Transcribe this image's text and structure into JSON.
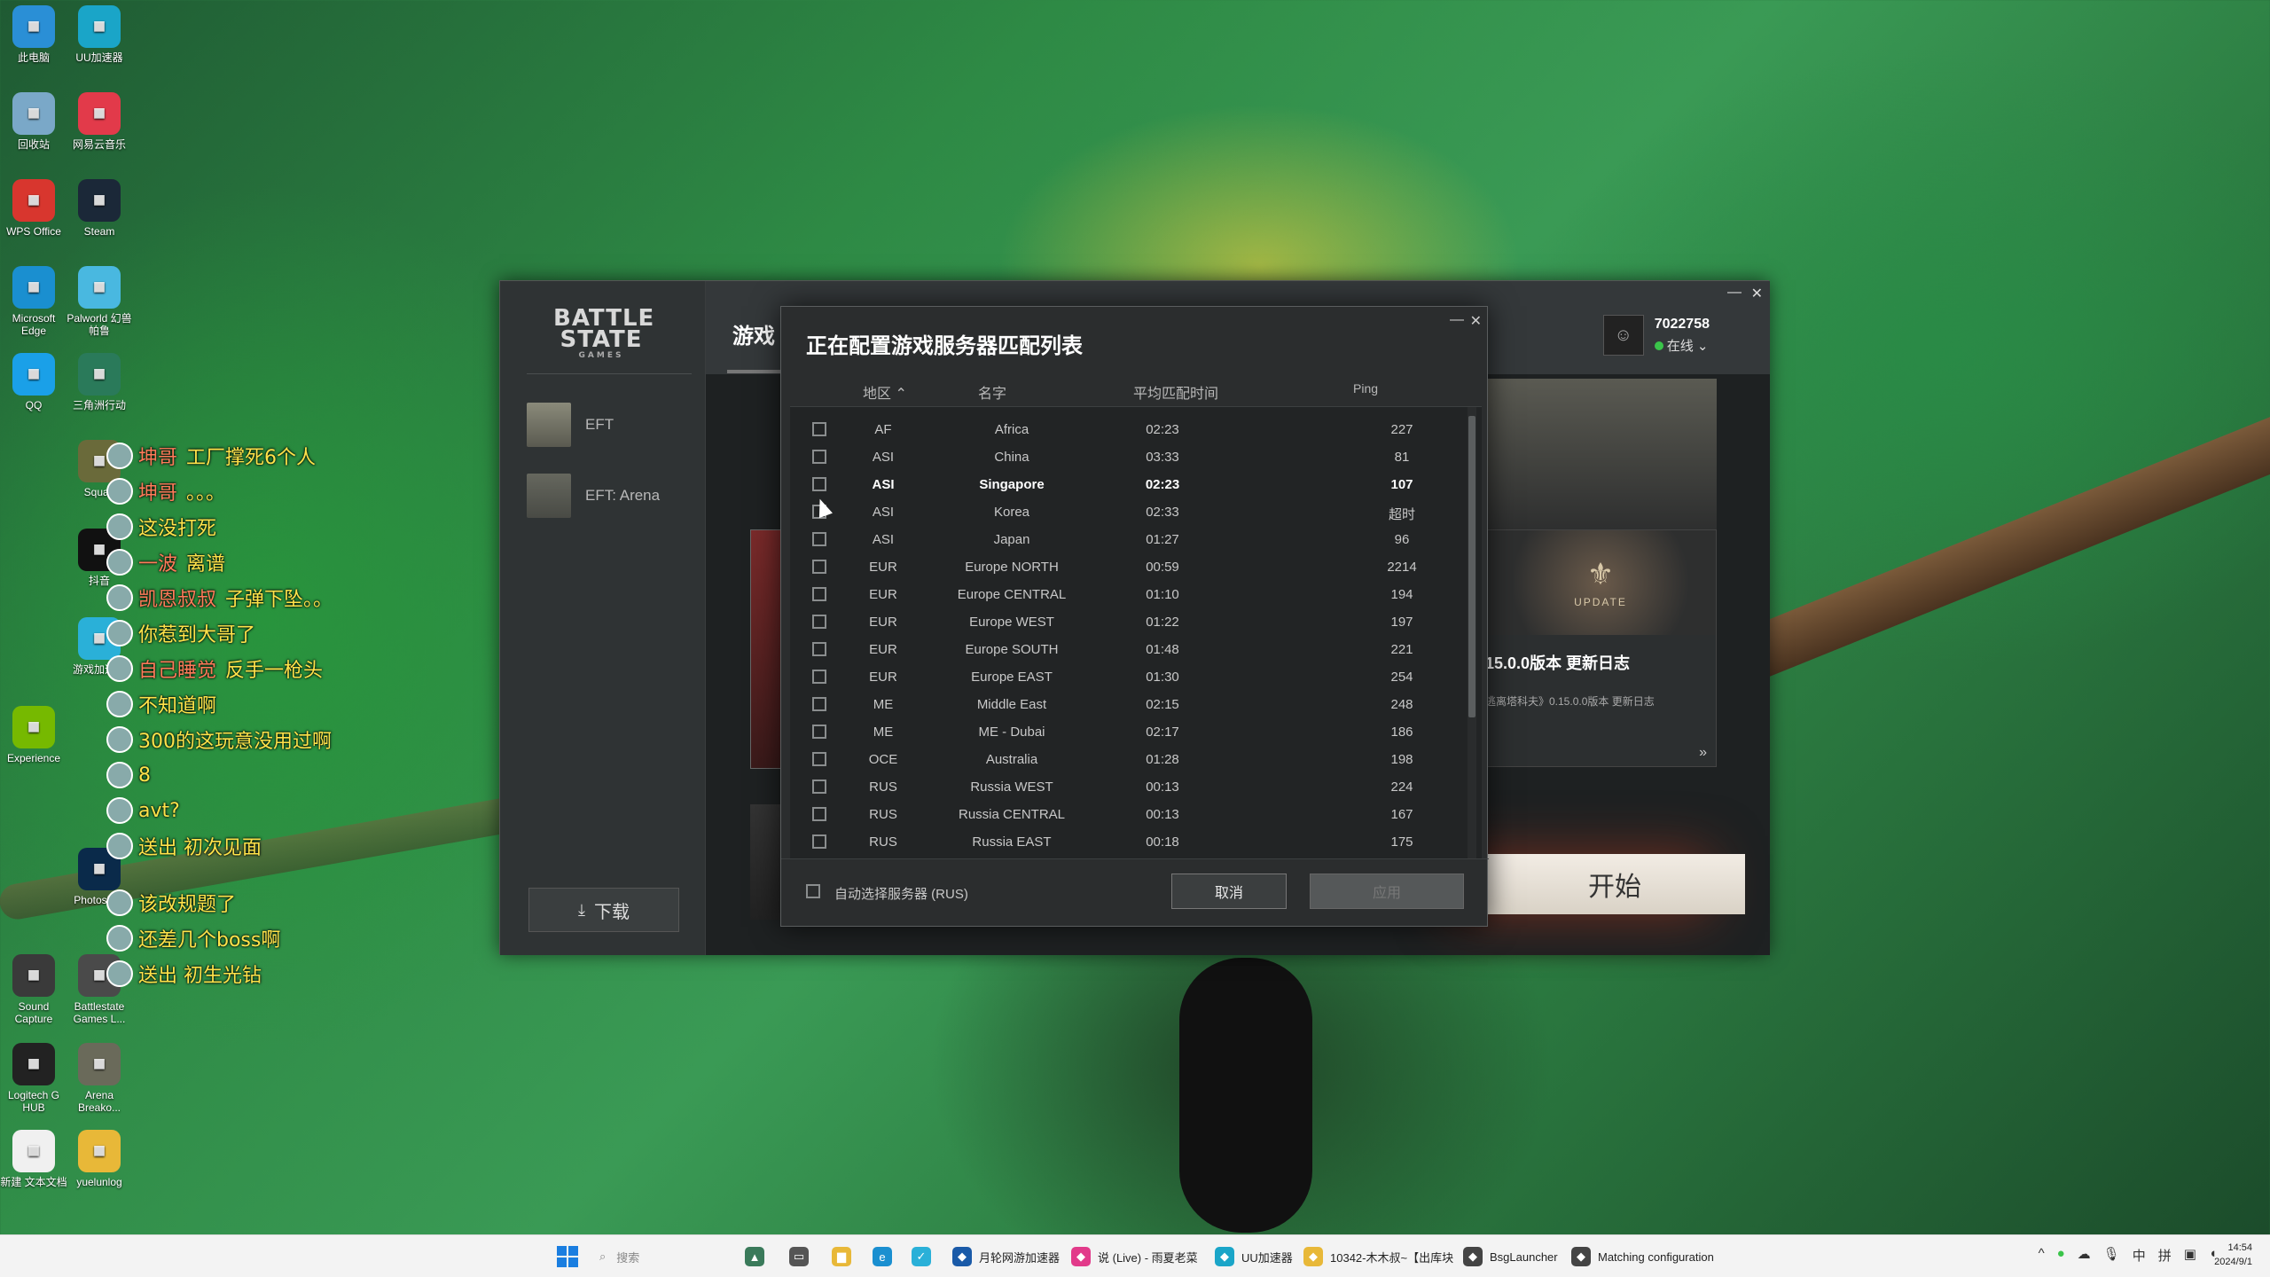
{
  "desktop_icons": [
    {
      "label": "此电脑",
      "icon": "computer-icon",
      "color": "#2a8fd6"
    },
    {
      "label": "UU加速器",
      "icon": "uu-accelerator-icon",
      "color": "#1aa5c8"
    },
    {
      "label": "回收站",
      "icon": "recycle-bin-icon",
      "color": "#7aa8c8"
    },
    {
      "label": "网易云音乐",
      "icon": "netease-music-icon",
      "color": "#e23a4a"
    },
    {
      "label": "WPS Office",
      "icon": "wps-icon",
      "color": "#d8362e"
    },
    {
      "label": "Steam",
      "icon": "steam-icon",
      "color": "#1b2838"
    },
    {
      "label": "Microsoft Edge",
      "icon": "edge-icon",
      "color": "#1a8fd0"
    },
    {
      "label": "Palworld 幻兽帕鲁",
      "icon": "palworld-icon",
      "color": "#49b8e0"
    },
    {
      "label": "QQ",
      "icon": "qq-icon",
      "color": "#1aa0e8"
    },
    {
      "label": "三角洲行动",
      "icon": "delta-force-icon",
      "color": "#2a7a5a"
    },
    {
      "label": "Squad",
      "icon": "squad-icon",
      "color": "#6a6a3a"
    },
    {
      "label": "抖音",
      "icon": "douyin-icon",
      "color": "#111111"
    },
    {
      "label": "游戏加速器",
      "icon": "game-accelerator-icon",
      "color": "#2ab0d8"
    },
    {
      "label": "Experience",
      "icon": "nvidia-icon",
      "color": "#76b900"
    },
    {
      "label": "Photoshop",
      "icon": "photoshop-icon",
      "color": "#0a2a4a"
    },
    {
      "label": "Sound Capture",
      "icon": "sound-capture-icon",
      "color": "#3a3a3a"
    },
    {
      "label": "Battlestate Games L...",
      "icon": "battlestate-icon",
      "color": "#4a4a4a"
    },
    {
      "label": "Logitech G HUB",
      "icon": "logitech-icon",
      "color": "#222222"
    },
    {
      "label": "Arena Breako...",
      "icon": "arena-breakout-icon",
      "color": "#6a6a5a"
    },
    {
      "label": "新建 文本文档",
      "icon": "text-file-icon",
      "color": "#f0f0f0"
    },
    {
      "label": "yuelunlog",
      "icon": "folder-icon",
      "color": "#e8b838"
    }
  ],
  "chat_overlay": [
    {
      "nick": "坤哥",
      "msg": "工厂撑死6个人"
    },
    {
      "nick": "坤哥",
      "msg": "。。。"
    },
    {
      "nick": "",
      "msg": "这没打死"
    },
    {
      "nick": "一波",
      "msg": "离谱"
    },
    {
      "nick": "凯恩叔叔",
      "msg": "子弹下坠。。"
    },
    {
      "nick": "",
      "msg": "你惹到大哥了"
    },
    {
      "nick": "自己睡觉",
      "msg": "反手一枪头"
    },
    {
      "nick": "",
      "msg": "不知道啊"
    },
    {
      "nick": "",
      "msg": "300的这玩意没用过啊"
    },
    {
      "nick": "",
      "msg": "8"
    },
    {
      "nick": "",
      "msg": "avt?"
    },
    {
      "nick": "",
      "msg": "送出 初次见面"
    },
    {
      "nick": "",
      "msg": "该改规题了"
    },
    {
      "nick": "",
      "msg": "还差几个boss啊"
    },
    {
      "nick": "",
      "msg": "送出 初生光钻"
    }
  ],
  "launcher": {
    "logo_main": "BATTLE STATE",
    "logo_sub": "GAMES",
    "games": [
      {
        "label": "EFT"
      },
      {
        "label": "EFT: Arena"
      }
    ],
    "download_label": "下载",
    "tab_label": "游戏",
    "user": {
      "name": "7022758",
      "status": "在线"
    },
    "news": {
      "badge": "UPDATE",
      "title": "15.0.0版本 更新日志",
      "desc": "逃离塔科夫》0.15.0.0版本 更新日志",
      "more": "»"
    },
    "start_label": "开始"
  },
  "dialog": {
    "title": "正在配置游戏服务器匹配列表",
    "columns": {
      "region": "地区",
      "name": "名字",
      "avg_time": "平均匹配时间",
      "ping": "Ping"
    },
    "rows": [
      {
        "region": "AF",
        "name": "Africa",
        "time": "02:23",
        "ping": "227",
        "bold": false
      },
      {
        "region": "ASI",
        "name": "China",
        "time": "03:33",
        "ping": "81",
        "bold": false
      },
      {
        "region": "ASI",
        "name": "Singapore",
        "time": "02:23",
        "ping": "107",
        "bold": true
      },
      {
        "region": "ASI",
        "name": "Korea",
        "time": "02:33",
        "ping": "超时",
        "bold": false
      },
      {
        "region": "ASI",
        "name": "Japan",
        "time": "01:27",
        "ping": "96",
        "bold": false
      },
      {
        "region": "EUR",
        "name": "Europe NORTH",
        "time": "00:59",
        "ping": "2214",
        "bold": false
      },
      {
        "region": "EUR",
        "name": "Europe CENTRAL",
        "time": "01:10",
        "ping": "194",
        "bold": false
      },
      {
        "region": "EUR",
        "name": "Europe WEST",
        "time": "01:22",
        "ping": "197",
        "bold": false
      },
      {
        "region": "EUR",
        "name": "Europe SOUTH",
        "time": "01:48",
        "ping": "221",
        "bold": false
      },
      {
        "region": "EUR",
        "name": "Europe EAST",
        "time": "01:30",
        "ping": "254",
        "bold": false
      },
      {
        "region": "ME",
        "name": "Middle East",
        "time": "02:15",
        "ping": "248",
        "bold": false
      },
      {
        "region": "ME",
        "name": "ME - Dubai",
        "time": "02:17",
        "ping": "186",
        "bold": false
      },
      {
        "region": "OCE",
        "name": "Australia",
        "time": "01:28",
        "ping": "198",
        "bold": false
      },
      {
        "region": "RUS",
        "name": "Russia WEST",
        "time": "00:13",
        "ping": "224",
        "bold": false
      },
      {
        "region": "RUS",
        "name": "Russia CENTRAL",
        "time": "00:13",
        "ping": "167",
        "bold": false
      },
      {
        "region": "RUS",
        "name": "Russia EAST",
        "time": "00:18",
        "ping": "175",
        "bold": false
      }
    ],
    "auto_select_label": "自动选择服务器 (RUS)",
    "cancel_label": "取消",
    "apply_label": "应用"
  },
  "taskbar": {
    "search_placeholder": "搜索",
    "items": [
      {
        "label": "月轮网游加速器",
        "icon": "yuelun-icon",
        "color": "#1a5aa8"
      },
      {
        "label": "说 (Live) - 雨夏老菜",
        "icon": "live-icon",
        "color": "#e23a8a"
      },
      {
        "label": "UU加速器",
        "icon": "uu-icon",
        "color": "#1aa5c8"
      },
      {
        "label": "10342-木木叔~【出库块",
        "icon": "stream-icon",
        "color": "#e8b838"
      },
      {
        "label": "BsgLauncher",
        "icon": "bsg-icon",
        "color": "#444444"
      },
      {
        "label": "Matching configuration",
        "icon": "bsg-icon",
        "color": "#444444"
      }
    ],
    "tray": [
      "^",
      "中",
      "拼"
    ],
    "time": "14:54",
    "date": "2024/9/1"
  }
}
